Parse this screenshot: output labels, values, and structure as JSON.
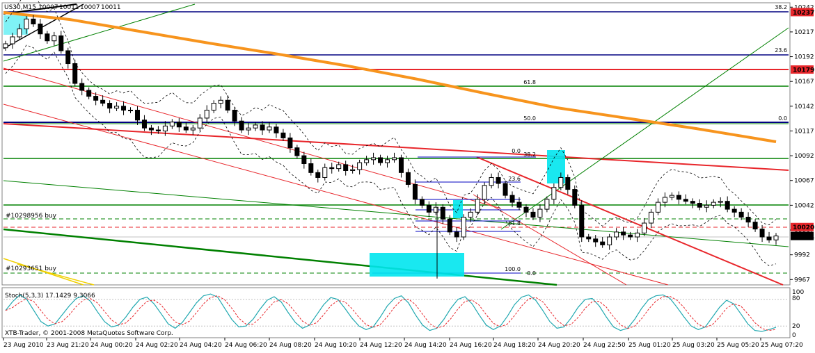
{
  "chart_data": [
    {
      "type": "candlestick",
      "title": "US30,M15",
      "ohlc_readout": [
        "10007",
        "10011",
        "10007",
        "10011"
      ],
      "y_ticks": [
        10242,
        10217,
        10192,
        10167,
        10142,
        10117,
        10092,
        10067,
        10042,
        10017,
        9992,
        9967
      ],
      "ylim": [
        9963,
        10245
      ],
      "x_ticks": [
        "23 Aug 2010",
        "23 Aug 21:20",
        "24 Aug 00:20",
        "24 Aug 02:20",
        "24 Aug 04:20",
        "24 Aug 06:20",
        "24 Aug 08:20",
        "24 Aug 10:20",
        "24 Aug 12:20",
        "24 Aug 14:20",
        "24 Aug 16:20",
        "24 Aug 18:20",
        "24 Aug 20:20",
        "24 Aug 22:50",
        "25 Aug 01:20",
        "25 Aug 03:20",
        "25 Aug 05:20",
        "25 Aug 07:20"
      ],
      "price_badges": [
        {
          "text": "10237",
          "value": 10237,
          "color": "#e8262b"
        },
        {
          "text": "10179",
          "value": 10179,
          "color": "#e8262b"
        },
        {
          "text": "10020",
          "value": 10020,
          "color": "#e8262b"
        },
        {
          "text": "10011",
          "value": 10011,
          "color": "#000000"
        }
      ],
      "fib_labels": [
        "38.2",
        "23.6",
        "61.8",
        "50.0",
        "0.0",
        "0.0",
        "38.2",
        "23.6",
        "61.8",
        "100.0",
        "0.0"
      ],
      "order_labels": [
        "#10298956 buy",
        "#10293651 buy"
      ],
      "watermark": "XTB-Trader, © 2001-2008 MetaQuotes Software Corp.",
      "colors": {
        "up": "#ffffff",
        "down": "#000000",
        "ma": "#f7941d",
        "hline_blue": "#000080",
        "hline_red": "#e8262b",
        "hline_green": "#008000",
        "box": "#00e5ee"
      },
      "close_path": [
        10205,
        10212,
        10220,
        10230,
        10225,
        10215,
        10208,
        10213,
        10198,
        10185,
        10165,
        10158,
        10152,
        10148,
        10145,
        10140,
        10142,
        10138,
        10138,
        10128,
        10120,
        10118,
        10117,
        10122,
        10126,
        10121,
        10118,
        10120,
        10130,
        10138,
        10145,
        10148,
        10138,
        10127,
        10118,
        10120,
        10123,
        10118,
        10121,
        10115,
        10110,
        10100,
        10092,
        10084,
        10075,
        10070,
        10080,
        10079,
        10083,
        10077,
        10078,
        10085,
        10088,
        10090,
        10085,
        10088,
        10090,
        10075,
        10063,
        10048,
        10042,
        10035,
        10040,
        10028,
        10015,
        10010,
        10030,
        10035,
        10048,
        10062,
        10070,
        10064,
        10052,
        10045,
        10040,
        10035,
        10030,
        10038,
        10048,
        10060,
        10070,
        10058,
        10042,
        10010,
        10008,
        10005,
        10002,
        10010,
        10015,
        10012,
        10010,
        10014,
        10024,
        10035,
        10045,
        10050,
        10052,
        10048,
        10046,
        10044,
        10040,
        10042,
        10045,
        10046,
        10038,
        10035,
        10030,
        10025,
        10018,
        10010,
        10007,
        10011
      ],
      "stoch": {
        "label": "Stoch(5,3,3) 17.1429 9.3066",
        "params": "5,3,3",
        "main": 17.1429,
        "signal": 9.3066,
        "levels": [
          80,
          20
        ],
        "ylim": [
          0,
          100
        ],
        "axis_labels": [
          "100",
          "80",
          "20",
          "0"
        ],
        "colors": {
          "main": "#20a8b0",
          "signal": "#e8262b"
        },
        "main_values": [
          55,
          75,
          90,
          80,
          55,
          30,
          20,
          25,
          45,
          65,
          82,
          88,
          76,
          52,
          30,
          18,
          22,
          40,
          62,
          80,
          85,
          70,
          48,
          25,
          15,
          28,
          50,
          72,
          88,
          92,
          85,
          60,
          35,
          18,
          20,
          35,
          58,
          78,
          86,
          74,
          50,
          28,
          15,
          22,
          45,
          68,
          84,
          80,
          60,
          38,
          20,
          12,
          18,
          40,
          65,
          82,
          88,
          72,
          45,
          22,
          10,
          15,
          35,
          60,
          80,
          86,
          70,
          45,
          22,
          12,
          20,
          42,
          68,
          85,
          90,
          78,
          55,
          30,
          15,
          18,
          38,
          62,
          80,
          82,
          65,
          40,
          18,
          10,
          15,
          35,
          60,
          80,
          88,
          90,
          82,
          62,
          40,
          20,
          12,
          18,
          40,
          62,
          78,
          70,
          48,
          25,
          10,
          8,
          12,
          17
        ]
      }
    }
  ]
}
